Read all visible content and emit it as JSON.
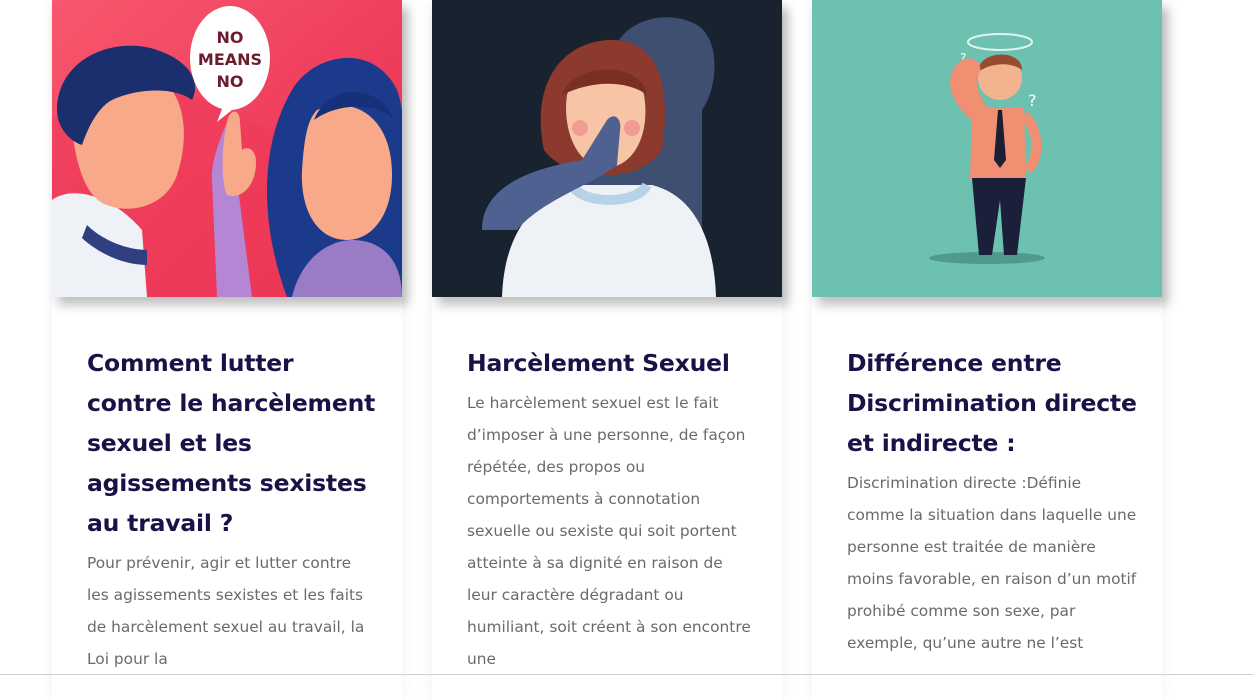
{
  "cards": [
    {
      "title": "Comment lutter contre le harcèlement sexuel et les agissements sexistes au travail ?",
      "excerpt": "Pour prévenir, agir et lutter contre les agissements sexistes et les faits de harcèlement sexuel au travail, la Loi pour la",
      "image_text": [
        "NO",
        "MEANS",
        "NO"
      ],
      "image_bg": "#f0405e"
    },
    {
      "title": "Harcèlement Sexuel",
      "excerpt": "Le harcèlement sexuel est le fait d’imposer à une personne, de façon répétée, des propos ou comportements à connotation sexuelle ou sexiste qui soit portent atteinte à sa dignité en raison de leur caractère dégradant ou humiliant, soit créent à son encontre une",
      "image_bg": "#19222f"
    },
    {
      "title": "Différence entre Discrimination directe et indirecte :",
      "excerpt": "Discrimination directe :Définie comme la situation dans laquelle une personne est traitée de manière moins favorable, en raison d’un motif prohibé comme son sexe, par exemple, qu’une autre ne l’est",
      "image_bg": "#6cc1b1"
    }
  ],
  "colors": {
    "title": "#1b1147",
    "excerpt": "#6a6a6a"
  }
}
